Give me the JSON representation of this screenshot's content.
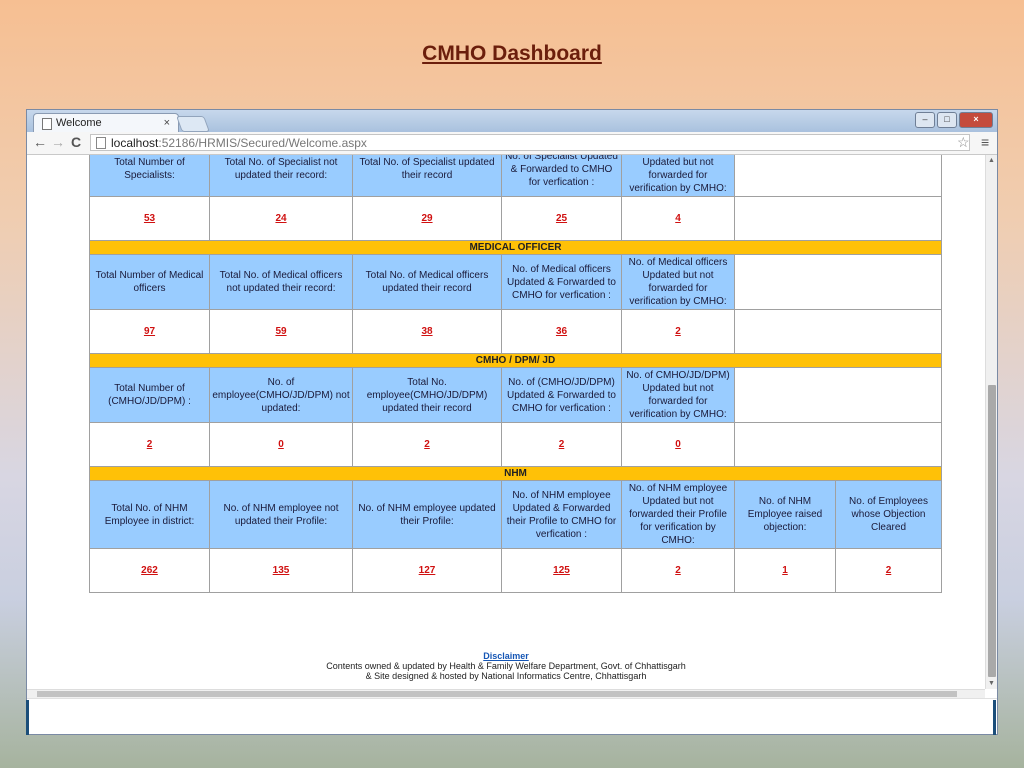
{
  "slide_title": "CMHO Dashboard",
  "browser": {
    "tab_label": "Welcome",
    "tab_close": "×",
    "url_host": "localhost",
    "url_path": ":52186/HRMIS/Secured/Welcome.aspx"
  },
  "specialists": {
    "headers": [
      "Total Number of Specialists:",
      "Total No. of Specialist not updated their record:",
      "Total No. of Specialist updated their record",
      "No. of Specialist Updated & Forwarded to CMHO for verfication :",
      "No. of Specialist Updated but not forwarded for verification by CMHO:"
    ],
    "values": [
      "53",
      "24",
      "29",
      "25",
      "4"
    ]
  },
  "medical_officer": {
    "title": "MEDICAL OFFICER",
    "headers": [
      "Total Number of Medical officers",
      "Total No. of Medical officers not updated their record:",
      "Total No. of Medical officers updated their record",
      "No. of Medical officers Updated & Forwarded to CMHO for verfication :",
      "No. of Medical officers Updated but not forwarded for verification by CMHO:"
    ],
    "values": [
      "97",
      "59",
      "38",
      "36",
      "2"
    ]
  },
  "cmho_dpm_jd": {
    "title": "CMHO / DPM/ JD",
    "headers": [
      "Total Number of (CMHO/JD/DPM) :",
      "No. of employee(CMHO/JD/DPM) not updated:",
      "Total No. employee(CMHO/JD/DPM) updated their record",
      "No. of (CMHO/JD/DPM) Updated & Forwarded to CMHO for verfication :",
      "No. of CMHO/JD/DPM) Updated but not forwarded for verification by CMHO:"
    ],
    "values": [
      "2",
      "0",
      "2",
      "2",
      "0"
    ]
  },
  "nhm": {
    "title": "NHM",
    "headers": [
      "Total No. of NHM Employee in district:",
      "No. of NHM employee not updated their Profile:",
      "No. of NHM employee updated their Profile:",
      "No. of NHM employee Updated & Forwarded their Profile to CMHO for verfication :",
      "No. of NHM employee Updated but not forwarded their Profile for verification by CMHO:",
      "No. of NHM Employee raised objection:",
      "No. of Employees whose Objection Cleared"
    ],
    "values": [
      "262",
      "135",
      "127",
      "125",
      "2",
      "1",
      "2"
    ]
  },
  "footer": {
    "disclaimer": "Disclaimer",
    "line1": "Contents owned & updated by Health & Family Welfare Department, Govt. of Chhattisgarh",
    "line2": "& Site designed & hosted by National Informatics Centre, Chhattisgarh"
  }
}
